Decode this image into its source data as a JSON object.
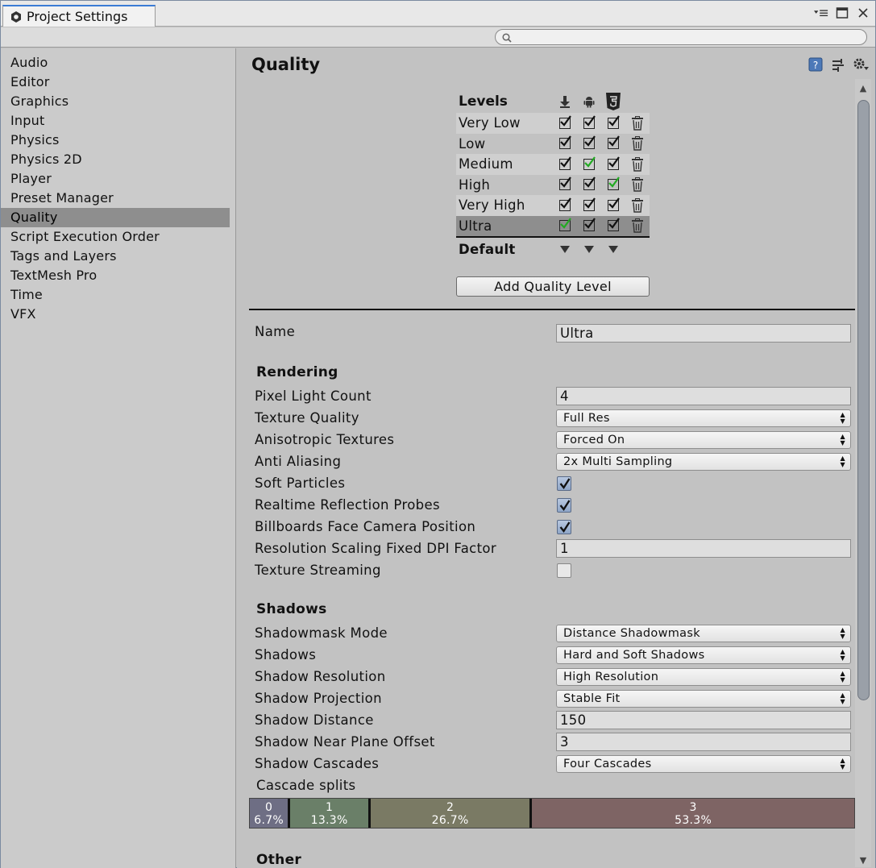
{
  "window": {
    "tab_title": "Project Settings",
    "controls": [
      "menu-icon",
      "maximize-icon",
      "close-icon"
    ]
  },
  "search": {
    "placeholder": ""
  },
  "sidebar": {
    "items": [
      {
        "label": "Audio"
      },
      {
        "label": "Editor"
      },
      {
        "label": "Graphics"
      },
      {
        "label": "Input"
      },
      {
        "label": "Physics"
      },
      {
        "label": "Physics 2D"
      },
      {
        "label": "Player"
      },
      {
        "label": "Preset Manager"
      },
      {
        "label": "Quality",
        "selected": true
      },
      {
        "label": "Script Execution Order"
      },
      {
        "label": "Tags and Layers"
      },
      {
        "label": "TextMesh Pro"
      },
      {
        "label": "Time"
      },
      {
        "label": "VFX"
      }
    ]
  },
  "main": {
    "title": "Quality",
    "levels": {
      "header": "Levels",
      "platforms": [
        "standalone-icon",
        "android-icon",
        "html5-icon"
      ],
      "rows": [
        {
          "name": "Very Low",
          "checks": [
            "on",
            "on",
            "on"
          ]
        },
        {
          "name": "Low",
          "checks": [
            "on",
            "on",
            "on"
          ]
        },
        {
          "name": "Medium",
          "checks": [
            "on",
            "default",
            "on"
          ]
        },
        {
          "name": "High",
          "checks": [
            "on",
            "on",
            "default"
          ]
        },
        {
          "name": "Very High",
          "checks": [
            "on",
            "on",
            "on"
          ]
        },
        {
          "name": "Ultra",
          "checks": [
            "default",
            "on",
            "on"
          ],
          "selected": true
        }
      ],
      "default_label": "Default",
      "default_color": "#22aa22"
    },
    "add_button": "Add Quality Level",
    "name_label": "Name",
    "name_value": "Ultra",
    "rendering": {
      "header": "Rendering",
      "pixel_light_count_label": "Pixel Light Count",
      "pixel_light_count": "4",
      "texture_quality_label": "Texture Quality",
      "texture_quality": "Full Res",
      "anisotropic_label": "Anisotropic Textures",
      "anisotropic": "Forced On",
      "anti_aliasing_label": "Anti Aliasing",
      "anti_aliasing": "2x Multi Sampling",
      "soft_particles_label": "Soft Particles",
      "soft_particles": true,
      "realtime_reflection_label": "Realtime Reflection Probes",
      "realtime_reflection": true,
      "billboards_label": "Billboards Face Camera Position",
      "billboards": true,
      "dpi_factor_label": "Resolution Scaling Fixed DPI Factor",
      "dpi_factor": "1",
      "texture_streaming_label": "Texture Streaming",
      "texture_streaming": false
    },
    "shadows": {
      "header": "Shadows",
      "shadowmask_label": "Shadowmask Mode",
      "shadowmask": "Distance Shadowmask",
      "shadows_label": "Shadows",
      "shadows": "Hard and Soft Shadows",
      "resolution_label": "Shadow Resolution",
      "resolution": "High Resolution",
      "projection_label": "Shadow Projection",
      "projection": "Stable Fit",
      "distance_label": "Shadow Distance",
      "distance": "150",
      "near_plane_label": "Shadow Near Plane Offset",
      "near_plane": "3",
      "cascades_label": "Shadow Cascades",
      "cascades": "Four Cascades",
      "cascade_splits_label": "Cascade splits",
      "cascade_splits": [
        {
          "index": "0",
          "percent": "6.7%",
          "fraction": 0.067,
          "color": "#6e6e84"
        },
        {
          "index": "1",
          "percent": "13.3%",
          "fraction": 0.133,
          "color": "#6a7f68"
        },
        {
          "index": "2",
          "percent": "26.7%",
          "fraction": 0.267,
          "color": "#7a7a64"
        },
        {
          "index": "3",
          "percent": "53.3%",
          "fraction": 0.533,
          "color": "#7e6464"
        }
      ]
    },
    "other_header": "Other"
  }
}
